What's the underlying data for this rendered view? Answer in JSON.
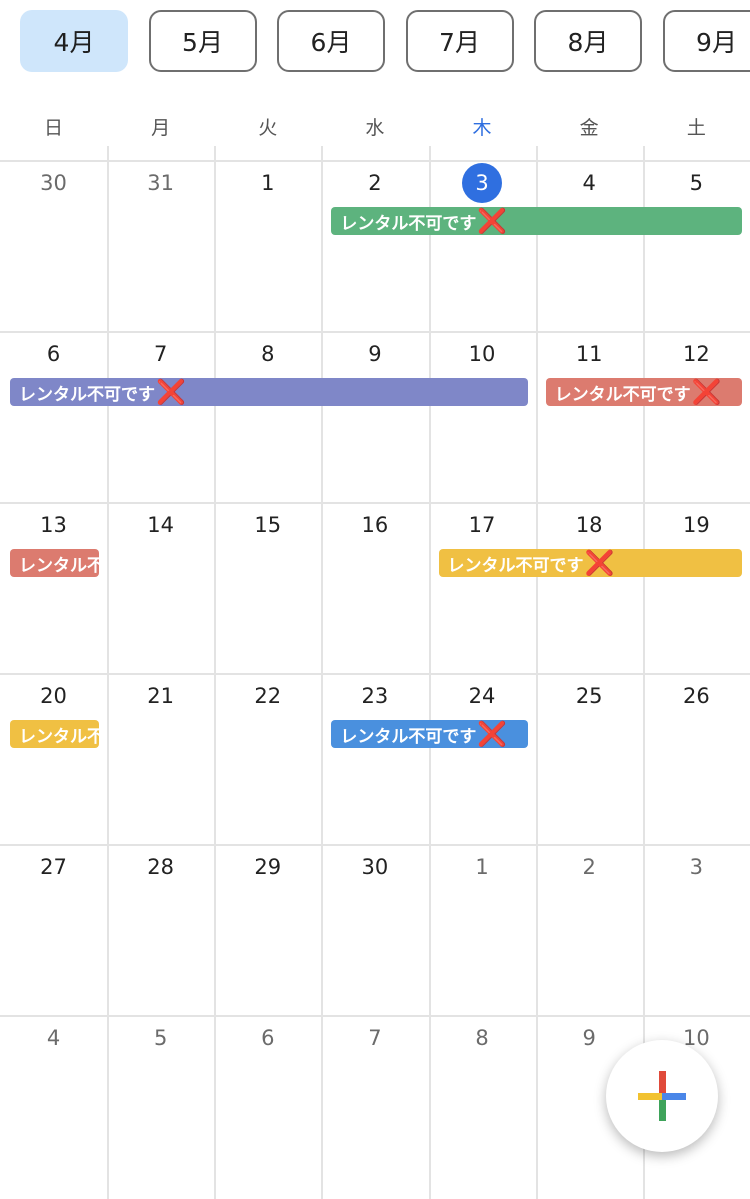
{
  "months": [
    "4月",
    "5月",
    "6月",
    "7月",
    "8月",
    "9月"
  ],
  "weekdays": [
    "日",
    "月",
    "火",
    "水",
    "木",
    "金",
    "土"
  ],
  "weeks": [
    [
      "30",
      "31",
      "1",
      "2",
      "3",
      "4",
      "5"
    ],
    [
      "6",
      "7",
      "8",
      "9",
      "10",
      "11",
      "12"
    ],
    [
      "13",
      "14",
      "15",
      "16",
      "17",
      "18",
      "19"
    ],
    [
      "20",
      "21",
      "22",
      "23",
      "24",
      "25",
      "26"
    ],
    [
      "27",
      "28",
      "29",
      "30",
      "1",
      "2",
      "3"
    ],
    [
      "4",
      "5",
      "6",
      "7",
      "8",
      "9",
      "10"
    ]
  ],
  "events": [
    {
      "week": 0,
      "start": 3,
      "end": 6,
      "text": "レンタル不可です",
      "mark": "❌",
      "color": "#5db37e"
    },
    {
      "week": 1,
      "start": 0,
      "end": 4,
      "text": "レンタル不可です",
      "mark": "❌",
      "color": "#7f87c8"
    },
    {
      "week": 1,
      "start": 5,
      "end": 6,
      "text": "レンタル不可です",
      "mark": "❌",
      "color": "#dc7b6f"
    },
    {
      "week": 2,
      "start": 0,
      "end": 0,
      "text": "レンタル不可です",
      "mark": "❌",
      "color": "#dc7b6f"
    },
    {
      "week": 2,
      "start": 4,
      "end": 6,
      "text": "レンタル不可です",
      "mark": "❌",
      "color": "#f0c043"
    },
    {
      "week": 3,
      "start": 0,
      "end": 0,
      "text": "レンタル不可です",
      "mark": "❌",
      "color": "#f0c043"
    },
    {
      "week": 3,
      "start": 3,
      "end": 4,
      "text": "レンタル不可です",
      "mark": "❌",
      "color": "#4a90de"
    }
  ],
  "colors": {
    "accent": "#2f6fe0",
    "active_month_bg": "#cfe6fb",
    "fab_red": "#e04a3a",
    "fab_blue": "#4a86e8",
    "fab_green": "#3ea35a",
    "fab_yellow": "#f2c230"
  },
  "icons": {
    "fab": "add-plus-icon"
  }
}
